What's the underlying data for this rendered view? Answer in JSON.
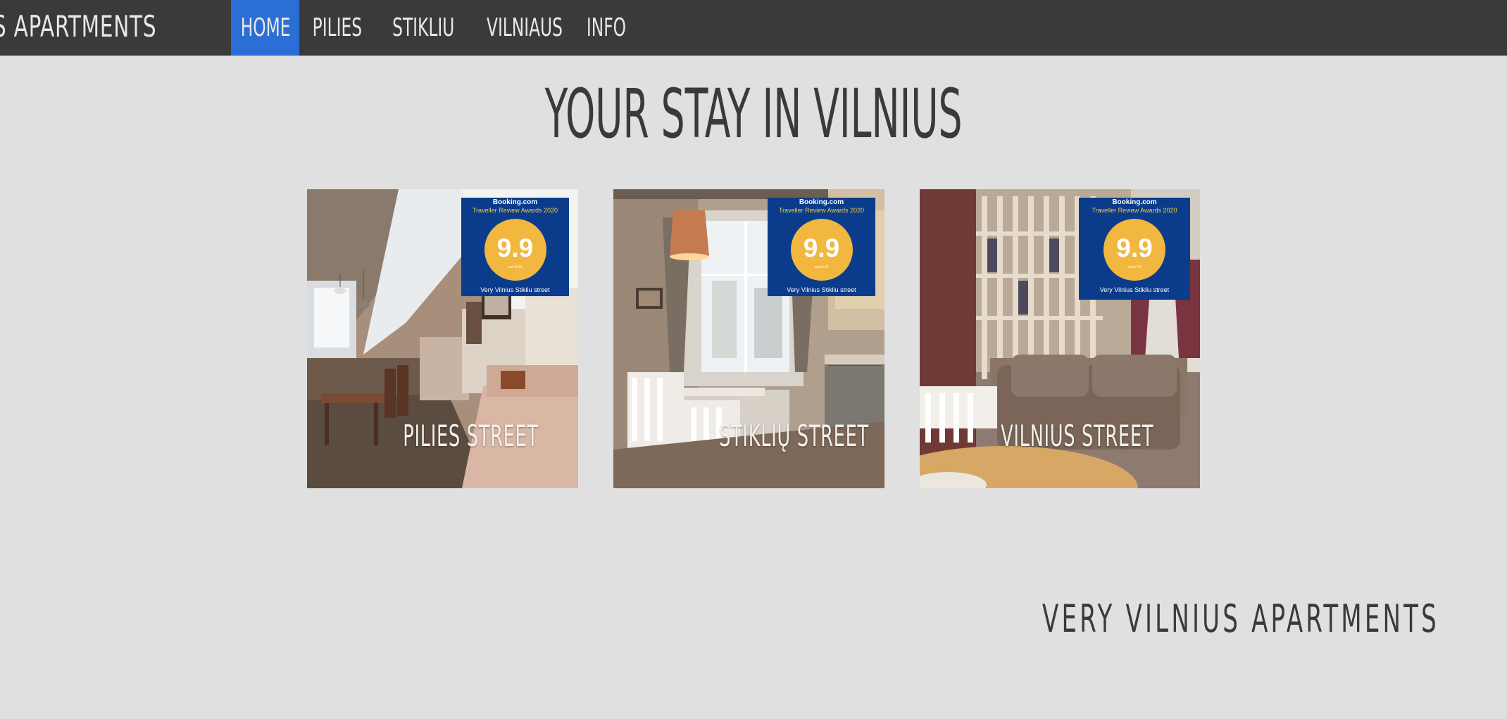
{
  "header": {
    "brand": "S APARTMENTS",
    "nav": [
      {
        "label": "HOME",
        "active": true
      },
      {
        "label": "PILIES",
        "active": false
      },
      {
        "label": "STIKLIU",
        "active": false
      },
      {
        "label": "VILNIAUS",
        "active": false
      },
      {
        "label": "INFO",
        "active": false
      }
    ]
  },
  "main": {
    "title": "YOUR STAY IN VILNIUS",
    "cards": [
      {
        "label": "PILIES STREET",
        "badge": {
          "brand": "Booking.com",
          "award": "Traveller Review Awards 2020",
          "score": "9.9",
          "out_of": "out of 10",
          "name": "Very Vilnius Stikliu street"
        }
      },
      {
        "label": "STIKLIŲ STREET",
        "badge": {
          "brand": "Booking.com",
          "award": "Traveller Review Awards 2020",
          "score": "9.9",
          "out_of": "out of 10",
          "name": "Very Vilnius Stikliu street"
        }
      },
      {
        "label": "VILNIUS STREET",
        "badge": {
          "brand": "Booking.com",
          "award": "Traveller Review Awards 2020",
          "score": "9.9",
          "out_of": "out of 10",
          "name": "Very Vilnius Stikliu street"
        }
      }
    ]
  },
  "footer": {
    "title": "VERY VILNIUS APARTMENTS"
  },
  "colors": {
    "nav_bg": "#3a3a3a",
    "nav_active": "#2a6ed6",
    "page_bg": "#e0e0e0",
    "text_dark": "#3a3a3a",
    "badge_blue": "#0b3c8c",
    "badge_gold": "#f1b73e"
  }
}
